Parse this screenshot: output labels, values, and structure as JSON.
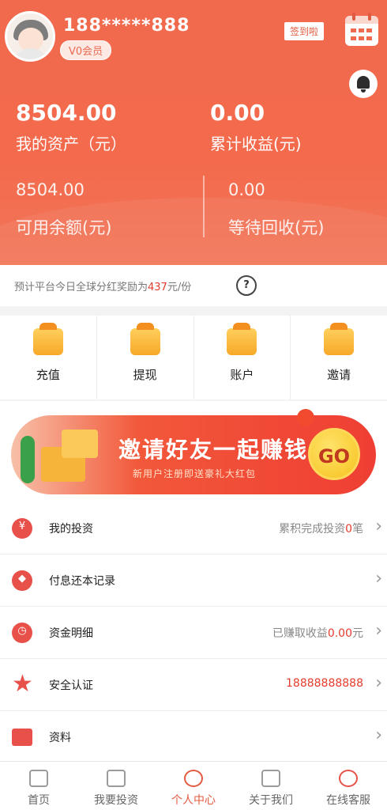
{
  "user": {
    "phone": "188*****888",
    "level": "V0会员"
  },
  "header": {
    "signed": "签到啦"
  },
  "assets": {
    "total_value": "8504.00",
    "total_label": "我的资产（元）",
    "earnings_value": "0.00",
    "earnings_label": "累计收益(元)",
    "available_value": "8504.00",
    "available_label": "可用余额(元)",
    "pending_value": "0.00",
    "pending_label": "等待回收(元)"
  },
  "notice": {
    "prefix": "预计平台今日全球分红奖励为",
    "amount": "437",
    "suffix": "元/份",
    "help": "?"
  },
  "actions": [
    {
      "label": "充值"
    },
    {
      "label": "提现"
    },
    {
      "label": "账户"
    },
    {
      "label": "邀请"
    }
  ],
  "banner": {
    "title": "邀请好友一起赚钱",
    "subtitle": "新用户注册即送豪礼大红包",
    "go": "GO"
  },
  "menu": [
    {
      "label": "我的投资",
      "value_prefix": "累积完成投资",
      "value_highlight": "0",
      "value_suffix": "笔",
      "glyph": "¥"
    },
    {
      "label": "付息还本记录",
      "value_prefix": "",
      "value_highlight": "",
      "value_suffix": "",
      "glyph": "◆"
    },
    {
      "label": "资金明细",
      "value_prefix": "已赚取收益",
      "value_highlight": "0.00",
      "value_suffix": "元",
      "glyph": "◷"
    },
    {
      "label": "安全认证",
      "value": "18888888888"
    },
    {
      "label": "资料"
    }
  ],
  "tabs": [
    {
      "label": "首页"
    },
    {
      "label": "我要投资"
    },
    {
      "label": "个人中心"
    },
    {
      "label": "关于我们"
    },
    {
      "label": "在线客服"
    }
  ],
  "colors": {
    "brand": "#f26a4e",
    "accent": "#e53b2c"
  }
}
